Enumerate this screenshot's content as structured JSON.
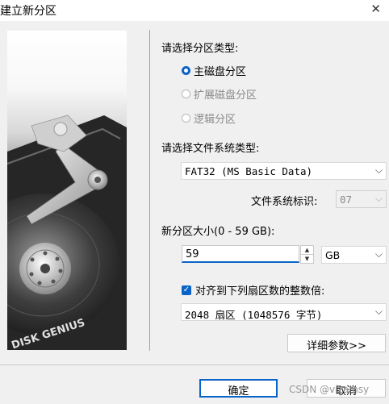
{
  "window": {
    "title": "建立新分区",
    "close_icon": "close-icon"
  },
  "illustration": {
    "brand": "DISK GENIUS"
  },
  "partition_type": {
    "label": "请选择分区类型:",
    "options": [
      {
        "label": "主磁盘分区",
        "checked": true,
        "enabled": true
      },
      {
        "label": "扩展磁盘分区",
        "checked": false,
        "enabled": false
      },
      {
        "label": "逻辑分区",
        "checked": false,
        "enabled": false
      }
    ]
  },
  "filesystem": {
    "label": "请选择文件系统类型:",
    "selected": "FAT32 (MS Basic Data)",
    "id_label": "文件系统标识:",
    "id_value": "07"
  },
  "size": {
    "label": "新分区大小(0 - 59 GB):",
    "value": "59",
    "unit": "GB"
  },
  "alignment": {
    "checkbox_label": "对齐到下列扇区数的整数倍:",
    "checked": true,
    "selected": "2048 扇区 (1048576 字节)"
  },
  "buttons": {
    "advanced": "详细参数>>",
    "ok": "确定",
    "cancel": "取消"
  },
  "watermark": "CSDN @vizamsy"
}
